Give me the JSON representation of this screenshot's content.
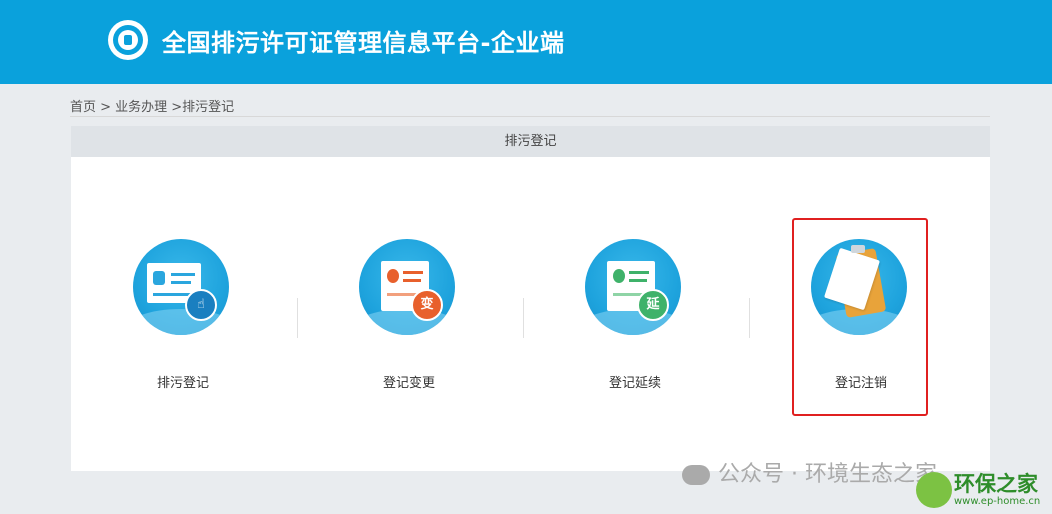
{
  "header": {
    "title": "全国排污许可证管理信息平台-企业端",
    "logo_icon": "national-emblem-logo",
    "background": "#0aa1dc"
  },
  "breadcrumb": "首页 > 业务办理 >排污登记",
  "panel": {
    "title": "排污登记",
    "cards": [
      {
        "label": "排污登记",
        "icon": "registration-card-hand-icon"
      },
      {
        "label": "登记变更",
        "icon": "certificate-change-icon",
        "badge": "变",
        "badge_color": "#e8602c"
      },
      {
        "label": "登记延续",
        "icon": "certificate-extend-icon",
        "badge": "延",
        "badge_color": "#3fb26a"
      },
      {
        "label": "登记注销",
        "icon": "clipboard-icon"
      }
    ],
    "highlight_color": "#e02020"
  },
  "watermark": "公众号 · 环境生态之家",
  "brand": {
    "name": "环保之家",
    "url": "www.ep-home.cn"
  }
}
